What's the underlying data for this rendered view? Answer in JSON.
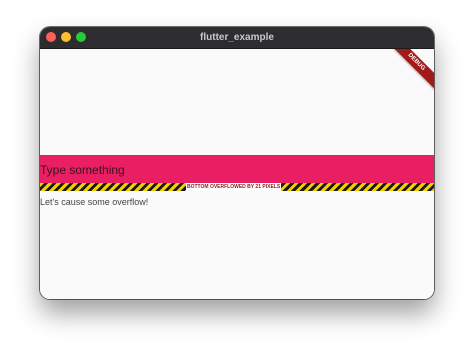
{
  "window": {
    "title": "flutter_example"
  },
  "text_field": {
    "placeholder": "Type something"
  },
  "overflow_indicator": {
    "label": "BOTTOM OVERFLOWED BY 21 PIXELS"
  },
  "body": {
    "text": "Let's cause some overflow!"
  },
  "debug_banner": {
    "label": "DEBUG"
  },
  "colors": {
    "accent": "#e91e63",
    "titlebar": "#2d2c2e",
    "close": "#fe5f57",
    "minimize": "#febc2e",
    "maximize": "#28c840",
    "debug_banner": "#a01a1a",
    "overflow_stripe_yellow": "#f5d000",
    "overflow_stripe_black": "#1a1a1a"
  }
}
